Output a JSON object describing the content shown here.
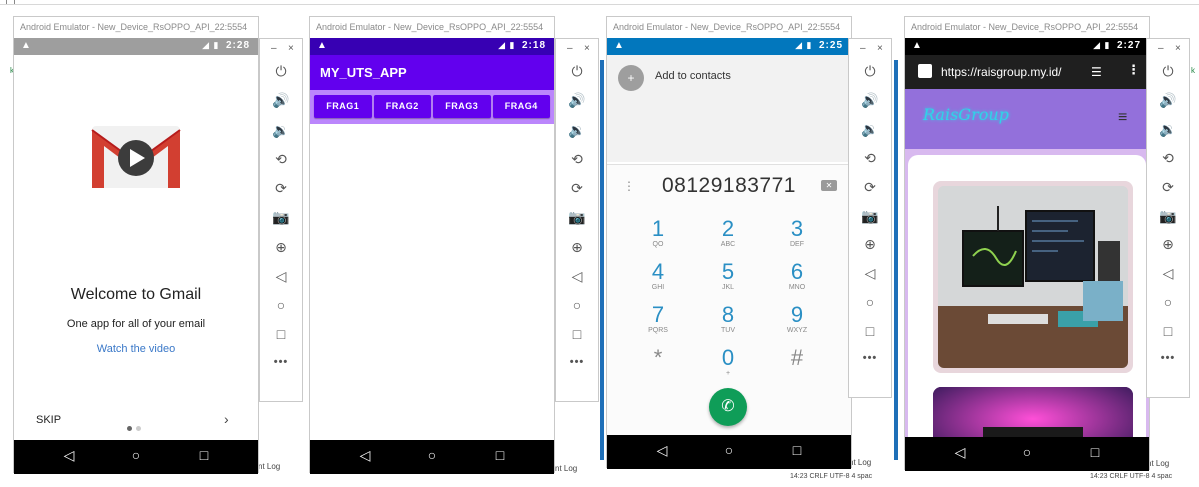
{
  "window_title": "Android Emulator - New_Device_RsOPPO_API_22:5554",
  "window_controls": {
    "minimize": "–",
    "close": "×"
  },
  "emulator_tools": [
    {
      "name": "power-icon",
      "glyph": "⏻"
    },
    {
      "name": "volume-up-icon",
      "glyph": "🔊"
    },
    {
      "name": "volume-down-icon",
      "glyph": "🔉"
    },
    {
      "name": "rotate-left-icon",
      "glyph": "⟲"
    },
    {
      "name": "rotate-right-icon",
      "glyph": "⟳"
    },
    {
      "name": "camera-icon",
      "glyph": "📷"
    },
    {
      "name": "zoom-icon",
      "glyph": "⊕"
    },
    {
      "name": "back-icon",
      "glyph": "◁"
    },
    {
      "name": "home-icon",
      "glyph": "○"
    },
    {
      "name": "overview-icon",
      "glyph": "□"
    },
    {
      "name": "more-icon",
      "glyph": "•••"
    }
  ],
  "emulators": [
    {
      "time": "2:28",
      "status_color": "#9e9e9e"
    },
    {
      "time": "2:18",
      "status_color": "#3700b3"
    },
    {
      "time": "2:25",
      "status_color": "#0277bd"
    },
    {
      "time": "2:27",
      "status_color": "#000000"
    }
  ],
  "background_fragments": {
    "k1": "k",
    "k2": "k",
    "log1": "nt Log",
    "log2": "nt Log",
    "log3": "nt Log",
    "log4": "nt Log",
    "status2": "14:23   CRLF   UTF-8   4 spac",
    "status3": "14:23   CRLF   UTF-8   4 spac"
  },
  "gmail": {
    "title": "Welcome to Gmail",
    "subtitle": "One app for all of your email",
    "link": "Watch the video",
    "skip": "SKIP",
    "next": "›"
  },
  "uts_app": {
    "title": "MY_UTS_APP",
    "tabs": [
      "FRAG1",
      "FRAG2",
      "FRAG3",
      "FRAG4"
    ]
  },
  "dialer": {
    "add_contact": "Add to contacts",
    "number": "08129183771",
    "keys": [
      {
        "digit": "1",
        "letters": "QO"
      },
      {
        "digit": "2",
        "letters": "ABC"
      },
      {
        "digit": "3",
        "letters": "DEF"
      },
      {
        "digit": "4",
        "letters": "GHI"
      },
      {
        "digit": "5",
        "letters": "JKL"
      },
      {
        "digit": "6",
        "letters": "MNO"
      },
      {
        "digit": "7",
        "letters": "PQRS"
      },
      {
        "digit": "8",
        "letters": "TUV"
      },
      {
        "digit": "9",
        "letters": "WXYZ"
      },
      {
        "digit": "*",
        "letters": ""
      },
      {
        "digit": "0",
        "letters": "+"
      },
      {
        "digit": "#",
        "letters": ""
      }
    ]
  },
  "browser": {
    "url": "https://raisgroup.my.id/",
    "logo": "RaisGroup"
  },
  "colors": {
    "uts_primary": "#6200ee",
    "uts_accent": "#bb86fc",
    "dialer_call": "#0f9d58",
    "dialer_digits": "#2a8fc4",
    "browser_header": "#9370db",
    "browser_body": "#d8b9ef",
    "gmail_link": "#3a78c8"
  }
}
